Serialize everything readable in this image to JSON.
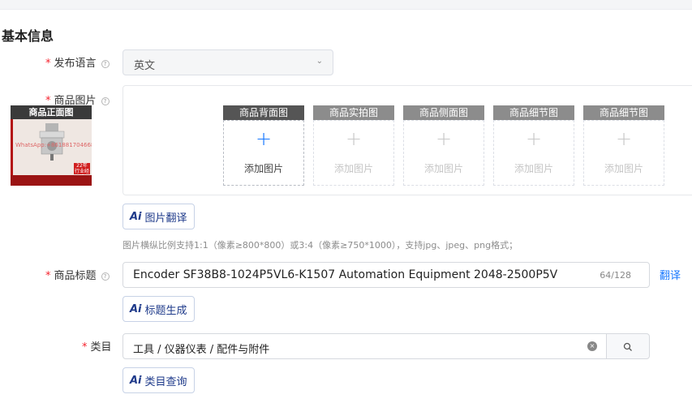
{
  "section": {
    "title": "基本信息"
  },
  "language": {
    "label": "发布语言",
    "value": "英文"
  },
  "images": {
    "label": "商品图片",
    "first_slot_label": "商品正面图",
    "slots": [
      {
        "label": "商品背面图",
        "add_text": "添加图片"
      },
      {
        "label": "商品实拍图",
        "add_text": "添加图片"
      },
      {
        "label": "商品侧面图",
        "add_text": "添加图片"
      },
      {
        "label": "商品细节图",
        "add_text": "添加图片"
      },
      {
        "label": "商品细节图",
        "add_text": "添加图片"
      }
    ],
    "thumb_watermark": "WhatsApp:+8618817046688",
    "thumb_badge": "22年 行业经验",
    "translate_button": "图片翻译",
    "hint": "图片横纵比例支持1:1（像素≥800*800）或3:4（像素≥750*1000），支持jpg、jpeg、png格式；"
  },
  "product_title": {
    "label": "商品标题",
    "value": "Encoder SF38B8-1024P5VL6-K1507 Automation Equipment 2048-2500P5V",
    "counter": "64/128",
    "translate_link": "翻译",
    "generate_button": "标题生成"
  },
  "category": {
    "label": "类目",
    "value": "工具 / 仪器仪表 / 配件与附件",
    "query_button": "类目查询"
  },
  "ai_badge": "Ai",
  "plus_glyph": "+",
  "help_glyph": "?",
  "clear_glyph": "×",
  "arrow_glyph": "⌄",
  "colors": {
    "primary": "#1677ff",
    "required": "#f5222d",
    "ai_text": "#1e3a8a"
  }
}
